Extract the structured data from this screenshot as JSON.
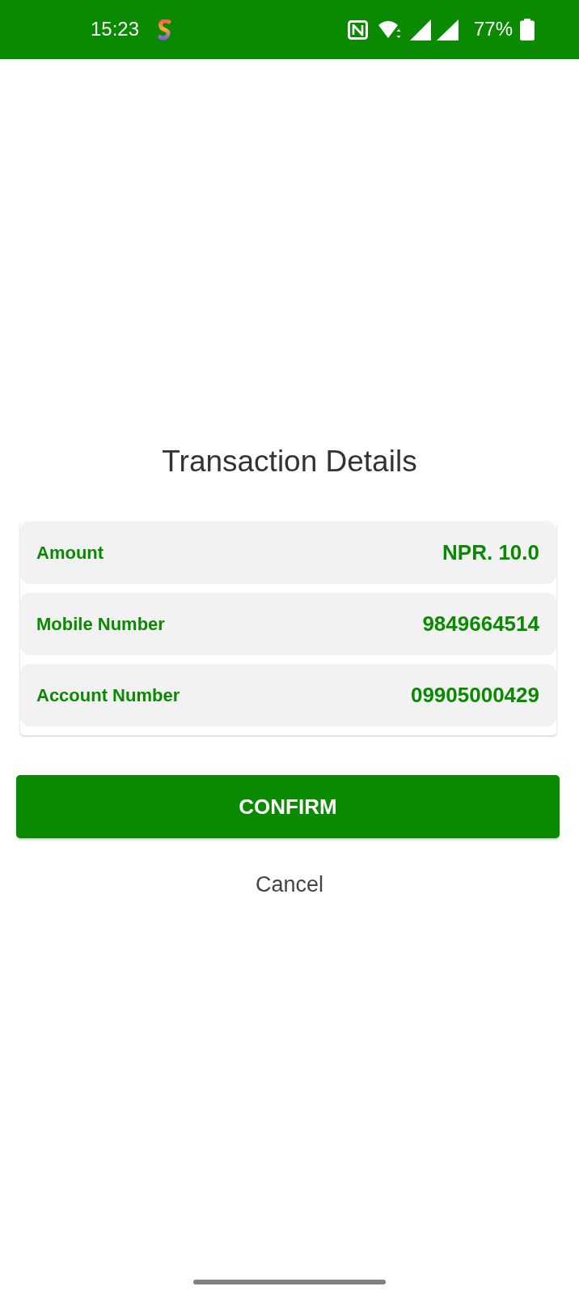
{
  "status_bar": {
    "time": "15:23",
    "battery": "77%"
  },
  "title": "Transaction Details",
  "details": [
    {
      "label": "Amount",
      "value": "NPR. 10.0"
    },
    {
      "label": "Mobile Number",
      "value": "9849664514"
    },
    {
      "label": "Account Number",
      "value": "09905000429"
    }
  ],
  "buttons": [
    {
      "kind": "primary",
      "label": "CONFIRM"
    },
    {
      "kind": "text",
      "label": "Cancel"
    }
  ]
}
